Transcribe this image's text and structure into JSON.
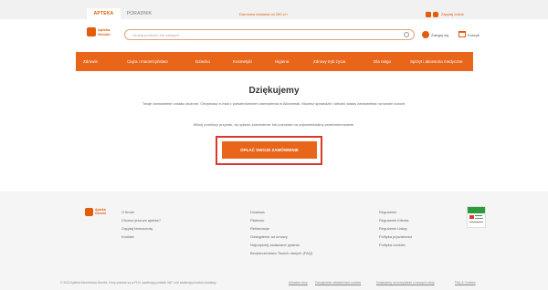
{
  "topbar": {
    "tabs": [
      "APTEKA",
      "PORADNIK"
    ],
    "promo": "Darmowa dostawa od 200 zł",
    "online_link": "Zapytaj online"
  },
  "header": {
    "logo_text_line1": "Apteka",
    "logo_text_line2": "Gemini",
    "search_placeholder": "Szukaj produktu lub kategorii",
    "login_label": "Zaloguj się",
    "cart_label": "Koszyk"
  },
  "nav": {
    "items": [
      "Zdrowie",
      "Ciąża i macierzyństwo",
      "Dziecko",
      "Kosmetyki",
      "Higiena",
      "Zdrowy tryb życia",
      "Dla niego",
      "Sprzęt i akcesoria medyczne"
    ]
  },
  "main": {
    "heading": "Dziękujemy",
    "info": "Twoje zamówienie zostało złożone. Otrzymasz e-mail z potwierdzeniem zamówienia w Aliorwmail. Możesz sprawdzić i śledzić status zamówienia na swoim koncie.",
    "pay_info": "Kliknij poniższy przycisk, by opłacić zamówienie lub pozostań na odpowiedzialny przeterminowanie.",
    "pay_button": "OPŁAĆ SWOJE ZAMÓWIENIE"
  },
  "footer": {
    "logo_line1": "Apteka",
    "logo_line2": "Gemini",
    "col1": [
      "O firmie",
      "Chcesz jeszcze apteke?",
      "Zapytaj farmaceutę",
      "Kontakt"
    ],
    "col2": [
      "Dostawa",
      "Płatność",
      "Reklamacje",
      "Odstąpienie od umowy",
      "Najczęściej zadawane pytania",
      "Bezpieczeństwo Twoich danych (FAQ)"
    ],
    "col3": [
      "Regulamin",
      "Regulamin Klienta",
      "Regulamin Usług",
      "Polityka prywatności",
      "Polityka cookies"
    ],
    "copyright": "© 2022 Apteka Internetowa Gemini. Ceny podane są w PLN, zawierają podatek VAT i nie zawierają kosztów dostawy.",
    "bottom_links": [
      "Aktualne ceny",
      "Zarządzanie ustawieniami cookies",
      "Dziękujemy za korzystanie z naszych usług",
      "FAQ & Cookies"
    ]
  },
  "colors": {
    "accent": "#e8651a",
    "highlight_border": "#d63a2c"
  }
}
